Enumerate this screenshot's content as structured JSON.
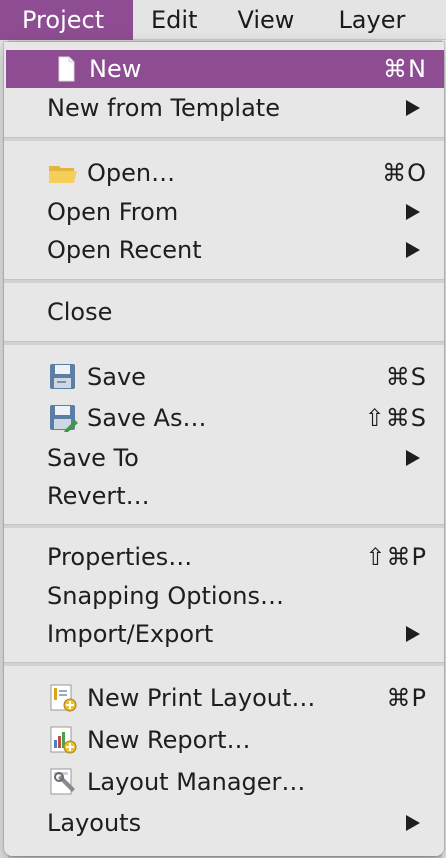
{
  "menubar": {
    "items": [
      {
        "label": "Project"
      },
      {
        "label": "Edit"
      },
      {
        "label": "View"
      },
      {
        "label": "Layer"
      }
    ]
  },
  "menu": {
    "items": {
      "new": {
        "label": "New",
        "shortcut": "⌘N",
        "icon": "new-document-icon"
      },
      "new_from_template": {
        "label": "New from Template"
      },
      "open": {
        "label": "Open…",
        "shortcut": "⌘O",
        "icon": "folder-icon"
      },
      "open_from": {
        "label": "Open From"
      },
      "open_recent": {
        "label": "Open Recent"
      },
      "close": {
        "label": "Close"
      },
      "save": {
        "label": "Save",
        "shortcut": "⌘S",
        "icon": "floppy-disk-icon"
      },
      "save_as": {
        "label": "Save As…",
        "shortcut": "⇧⌘S",
        "icon": "floppy-disk-edit-icon"
      },
      "save_to": {
        "label": "Save To"
      },
      "revert": {
        "label": "Revert…"
      },
      "properties": {
        "label": "Properties…",
        "shortcut": "⇧⌘P"
      },
      "snapping_options": {
        "label": "Snapping Options…"
      },
      "import_export": {
        "label": "Import/Export"
      },
      "new_print_layout": {
        "label": "New Print Layout…",
        "shortcut": "⌘P",
        "icon": "print-layout-icon"
      },
      "new_report": {
        "label": "New Report…",
        "icon": "report-icon"
      },
      "layout_manager": {
        "label": "Layout Manager…",
        "icon": "layout-manager-icon"
      },
      "layouts": {
        "label": "Layouts"
      }
    }
  },
  "colors": {
    "accent": "#8e4d92",
    "menu_background": "#e7e7e7",
    "text": "#1e1e1e"
  }
}
